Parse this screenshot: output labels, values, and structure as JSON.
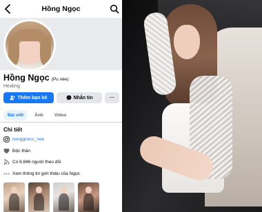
{
  "header": {
    "title": "Hồng Ngọc",
    "back_icon": "chevron-left-icon",
    "search_icon": "search-icon"
  },
  "profile": {
    "name": "Hồng Ngọc",
    "nickname": "(Pu née)",
    "bio": "Healing"
  },
  "actions": {
    "add_friend": "Thêm bạn bè",
    "message": "Nhắn tin",
    "more": "···"
  },
  "tabs": [
    {
      "label": "Bài viết",
      "active": true
    },
    {
      "label": "Ảnh",
      "active": false
    },
    {
      "label": "Video",
      "active": false
    }
  ],
  "details": {
    "title": "Chi tiết",
    "instagram": "nonggnocc_nee",
    "relationship": "Độc thân",
    "followers": "Có 6.846 người theo dõi",
    "more_info": "Xem thông tin giới thiệu của Ngọc"
  },
  "colors": {
    "accent": "#1877f2",
    "secondary_button": "#e4e6eb",
    "muted_text": "#65676b"
  }
}
